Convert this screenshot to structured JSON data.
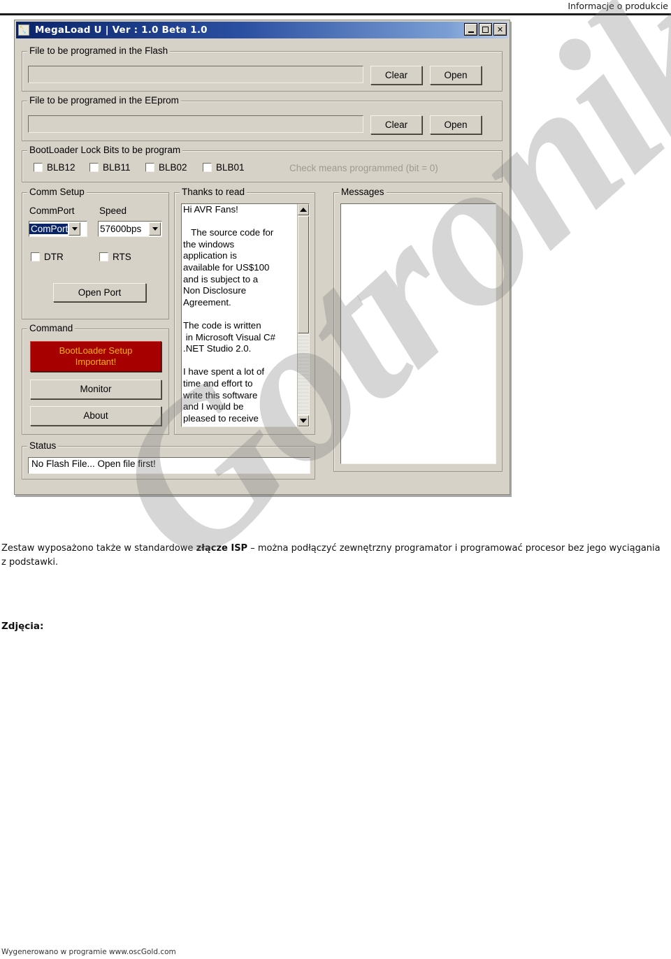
{
  "page": {
    "header_title": "Informacje o produkcie",
    "footer_text": "Wygenerowano w programie www.oscGold.com",
    "watermark_text": "Gotronik",
    "body_paragraph_pre": "Zestaw wyposażono także w standardowe ",
    "body_paragraph_bold": "złącze ISP",
    "body_paragraph_post": " – można podłączyć zewnętrzny programator i programować procesor bez jego wyciągania z podstawki.",
    "photos_label": "Zdjęcia:"
  },
  "app": {
    "title": "MegaLoad U | Ver : 1.0 Beta 1.0",
    "icon_name": "megaload-app-icon",
    "window_buttons": {
      "minimize": "_",
      "maximize": "□",
      "close": "✕"
    },
    "flash_group": {
      "title": "File to be programed in the Flash",
      "path_value": "",
      "clear_label": "Clear",
      "open_label": "Open"
    },
    "eeprom_group": {
      "title": "File to be programed in the EEprom",
      "path_value": "",
      "clear_label": "Clear",
      "open_label": "Open"
    },
    "lockbits_group": {
      "title": "BootLoader Lock Bits to be program",
      "hint": "Check means programmed (bit = 0)",
      "checkboxes": [
        {
          "label": "BLB12",
          "checked": false
        },
        {
          "label": "BLB11",
          "checked": false
        },
        {
          "label": "BLB02",
          "checked": false
        },
        {
          "label": "BLB01",
          "checked": false
        }
      ]
    },
    "comm_group": {
      "title": "Comm Setup",
      "commport_label": "CommPort",
      "commport_value": "ComPort",
      "speed_label": "Speed",
      "speed_value": "57600bps",
      "dtr_label": "DTR",
      "rts_label": "RTS",
      "open_port_label": "Open Port"
    },
    "command_group": {
      "title": "Command",
      "bootloader_line1": "BootLoader Setup",
      "bootloader_line2": "Important!",
      "bootloader_bg": "#a60000",
      "bootloader_fg": "#f5b300",
      "monitor_label": "Monitor",
      "about_label": "About"
    },
    "thanks_group": {
      "title": "Thanks to read",
      "text": "Hi AVR Fans!\n\n   The source code for\nthe windows\napplication is\navailable for US$100\nand is subject to a\nNon Disclosure\nAgreement.\n\nThe code is written\n in Microsoft Visual C#\n.NET Studio 2.0.\n\nI have spent a lot of\ntime and effort to\nwrite this software\nand I would be\npleased to receive"
    },
    "messages_group": {
      "title": "Messages",
      "items": []
    },
    "status_group": {
      "title": "Status",
      "text": "No Flash File...  Open file first!"
    }
  }
}
